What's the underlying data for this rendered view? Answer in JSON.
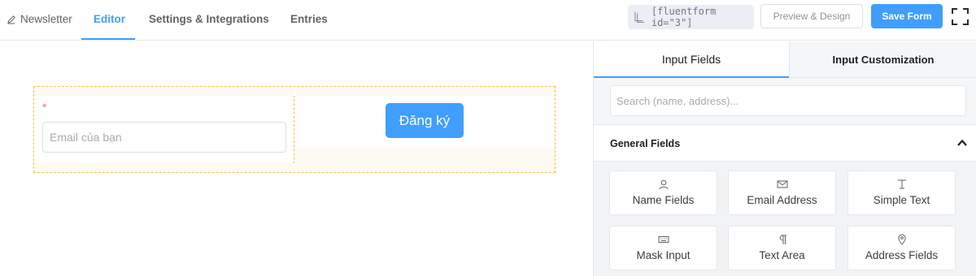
{
  "header": {
    "breadcrumb": "Newsletter",
    "tabs": [
      {
        "label": "Editor",
        "active": true
      },
      {
        "label": "Settings & Integrations",
        "active": false
      },
      {
        "label": "Entries",
        "active": false
      }
    ],
    "shortcode": "[fluentform id=\"3\"]",
    "preview_label": "Preview & Design",
    "save_label": "Save Form",
    "icons": {
      "breadcrumb": "pencil-icon",
      "shortcode": "copy-icon",
      "fullscreen": "fullscreen-icon"
    }
  },
  "form": {
    "required_mark": "*",
    "email_placeholder": "Email của bạn",
    "submit_label": "Đăng ký"
  },
  "sidebar": {
    "tabs": [
      {
        "label": "Input Fields",
        "active": true
      },
      {
        "label": "Input Customization",
        "active": false
      }
    ],
    "search_placeholder": "Search (name, address)...",
    "section_title": "General Fields",
    "fields": [
      {
        "label": "Name Fields",
        "icon": "user-icon"
      },
      {
        "label": "Email Address",
        "icon": "envelope-icon"
      },
      {
        "label": "Simple Text",
        "icon": "text-cursor-icon"
      },
      {
        "label": "Mask Input",
        "icon": "keyboard-icon"
      },
      {
        "label": "Text Area",
        "icon": "paragraph-icon"
      },
      {
        "label": "Address Fields",
        "icon": "map-pin-icon"
      }
    ]
  },
  "colors": {
    "accent": "#409eff",
    "required": "#f56c6c",
    "column_border": "#f0c44c"
  }
}
